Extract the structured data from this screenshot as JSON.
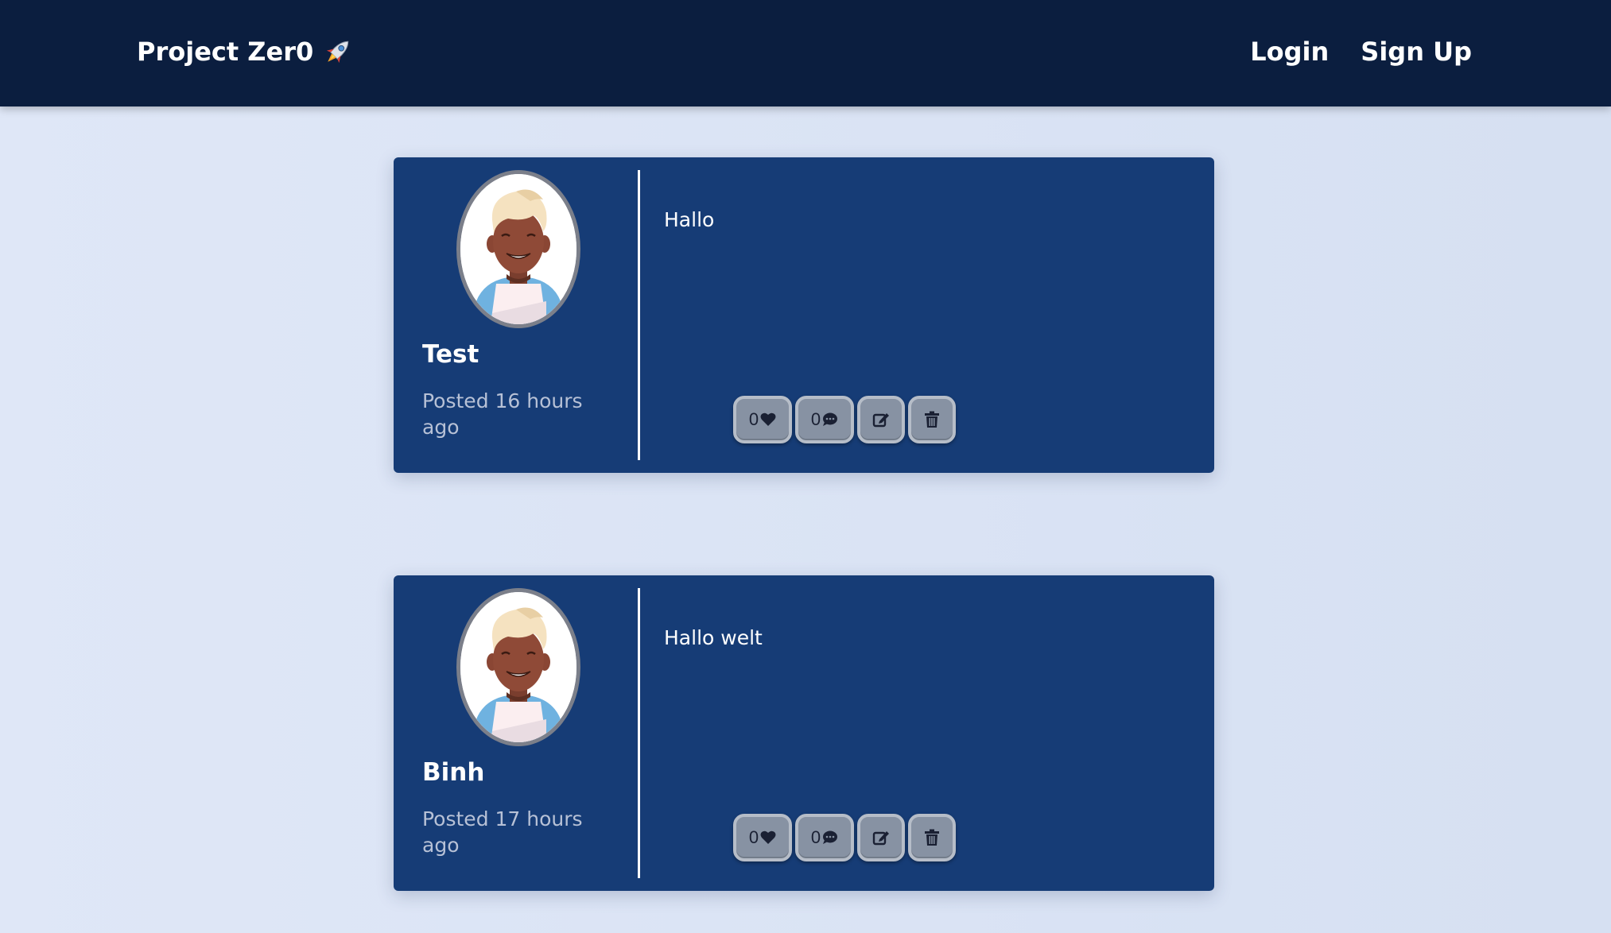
{
  "navbar": {
    "brand": "Project Zer0",
    "brand_icon": "rocket-icon",
    "links": {
      "login": "Login",
      "signup": "Sign Up"
    }
  },
  "posts": [
    {
      "author": "Test",
      "posted": "Posted 16 hours ago",
      "content": "Hallo",
      "likes": "0",
      "comments": "0"
    },
    {
      "author": "Binh",
      "posted": "Posted 17 hours ago",
      "content": "Hallo welt",
      "likes": "0",
      "comments": "0"
    }
  ],
  "colors": {
    "navbar": "#0b1e3f",
    "card": "#163c76",
    "page_background": "#dfe7f7",
    "button": "#8792a3"
  },
  "icons": [
    "rocket-icon",
    "heart-icon",
    "comment-icon",
    "edit-icon",
    "trash-icon"
  ]
}
